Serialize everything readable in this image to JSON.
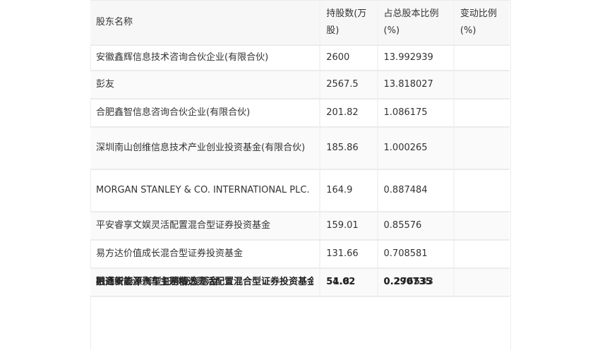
{
  "table": {
    "headers": [
      "股东名称",
      "持股数(万股)",
      "占总股本比例(%)",
      "变动比例(%)"
    ],
    "rows": [
      {
        "name": "安徽鑫辉信息技术咨询合伙企业(有限合伙)",
        "shares": "2600",
        "ratio": "13.992939",
        "change": ""
      },
      {
        "name": "彭友",
        "shares": "2567.5",
        "ratio": "13.818027",
        "change": ""
      },
      {
        "name": "合肥鑫智信息咨询合伙企业(有限合伙)",
        "shares": "201.82",
        "ratio": "1.086175",
        "change": ""
      },
      {
        "name": "深圳南山创维信息技术产业创业投资基金(有限合伙)",
        "shares": "185.86",
        "ratio": "1.000265",
        "change": ""
      },
      {
        "name": "MORGAN STANLEY & CO. INTERNATIONAL PLC.",
        "shares": "164.9",
        "ratio": "0.887484",
        "change": ""
      },
      {
        "name": "平安睿享文娱灵活配置混合型证券投资基金",
        "shares": "159.01",
        "ratio": "0.85576",
        "change": ""
      },
      {
        "name": "易方达价值成长混合型证券投资基金",
        "shares": "131.66",
        "ratio": "0.708581",
        "change": ""
      }
    ],
    "overlapped_row": {
      "name_a": "融通新能源汽车主题精选灵活配置混合型证券投资基金",
      "name_b": "招商安泰平衡型证券投资基金",
      "shares_a": "54.02",
      "shares_b": "51.8",
      "ratio_a": "0.290735",
      "ratio_b": "0.276533",
      "change": ""
    }
  }
}
